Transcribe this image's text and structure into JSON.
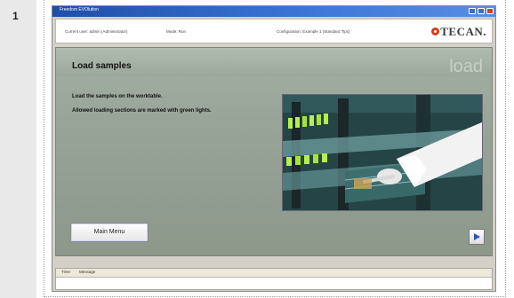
{
  "step": {
    "number": "1"
  },
  "window": {
    "title": "Freedom EVOlution",
    "controls": [
      "minimize-icon",
      "maximize-icon",
      "close-icon"
    ]
  },
  "infobar": {
    "current_user": "Current user: admin (Administrator)",
    "mode": "Mode: Run",
    "configuration": "Configuration: Example 1 (Standard Tips)",
    "logo_text": "TECAN."
  },
  "main": {
    "title": "Load samples",
    "watermark": "load",
    "instruction_1": "Load the samples on the worktable.",
    "instruction_2": "Allowed loading sections are marked with green lights.",
    "main_menu_label": "Main Menu",
    "next_icon": "play-arrow-icon"
  },
  "log": {
    "columns": [
      "Time",
      "Message"
    ]
  },
  "colors": {
    "panel": "#97a397",
    "titlebar": "#1e4ea8",
    "logo_mark": "#d93a1d",
    "led_green": "#b6f04a"
  }
}
